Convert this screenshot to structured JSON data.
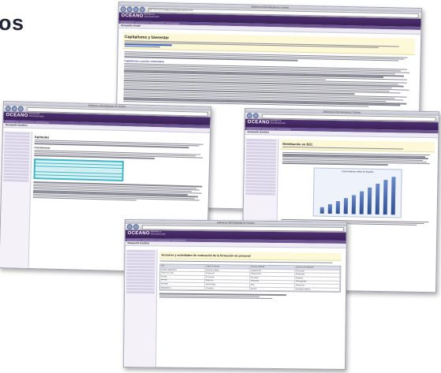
{
  "heading": "os",
  "windows": {
    "w1": {
      "title": "Biblioteca Informatizada de Océano",
      "url": "http://www.oceanodigital.com/biblioteca/index.html",
      "brand": "OCEANO",
      "brand_sub": "biblioteca informatizada",
      "search_label": "Búsqueda simple",
      "article_title": "Capitalismo y bienestar",
      "sub_heading": "Capitalismo y acción comunitaria",
      "link1": "Capitalismo y acción comunitaria",
      "link2": "Planificación y bienestar"
    },
    "w2": {
      "title": "Biblioteca Informatizada de Océano",
      "brand": "OCEANO",
      "brand_sub": "biblioteca informatizada",
      "search_label": "Búsqueda temática",
      "article_title": "Aptitudes",
      "sub_heading": "Cuestionarios"
    },
    "w3": {
      "title": "Biblioteca Informatizada de Océano",
      "brand": "OCEANO",
      "brand_sub": "biblioteca informatizada",
      "search_label": "Búsqueda temática",
      "article_title": "Distribución en B2C",
      "chart_label": "Consumidores online en España"
    },
    "w4": {
      "title": "Biblioteca Informatizada de Océano",
      "brand": "OCEANO",
      "brand_sub": "biblioteca informatizada",
      "search_label": "Búsqueda temática",
      "article_title": "Acciones y actividades de evaluación de la formación de personal",
      "columns": [
        "Tipo",
        "Lugar de estudio",
        "Técnica utilizada",
        "Quién es el evaluador"
      ],
      "rows": [
        [
          "Estudio diagnóstico",
          "Nivel de calidad",
          "Cuestionario",
          "Formación"
        ],
        [
          "Puntos de vista",
          "Evaluación",
          "Observación",
          "Profesores"
        ],
        [
          "Prueba",
          "Formación",
          "Encuesta",
          "Expertos"
        ],
        [
          "Pre-test",
          "Reacción",
          "Entrevista",
          "Participantes"
        ],
        [
          "Post-test",
          "Aprendizaje",
          "Test",
          "Supervisor"
        ],
        [
          "Seguimiento",
          "Conducta",
          "Control",
          "Evaluador externo"
        ]
      ]
    }
  }
}
